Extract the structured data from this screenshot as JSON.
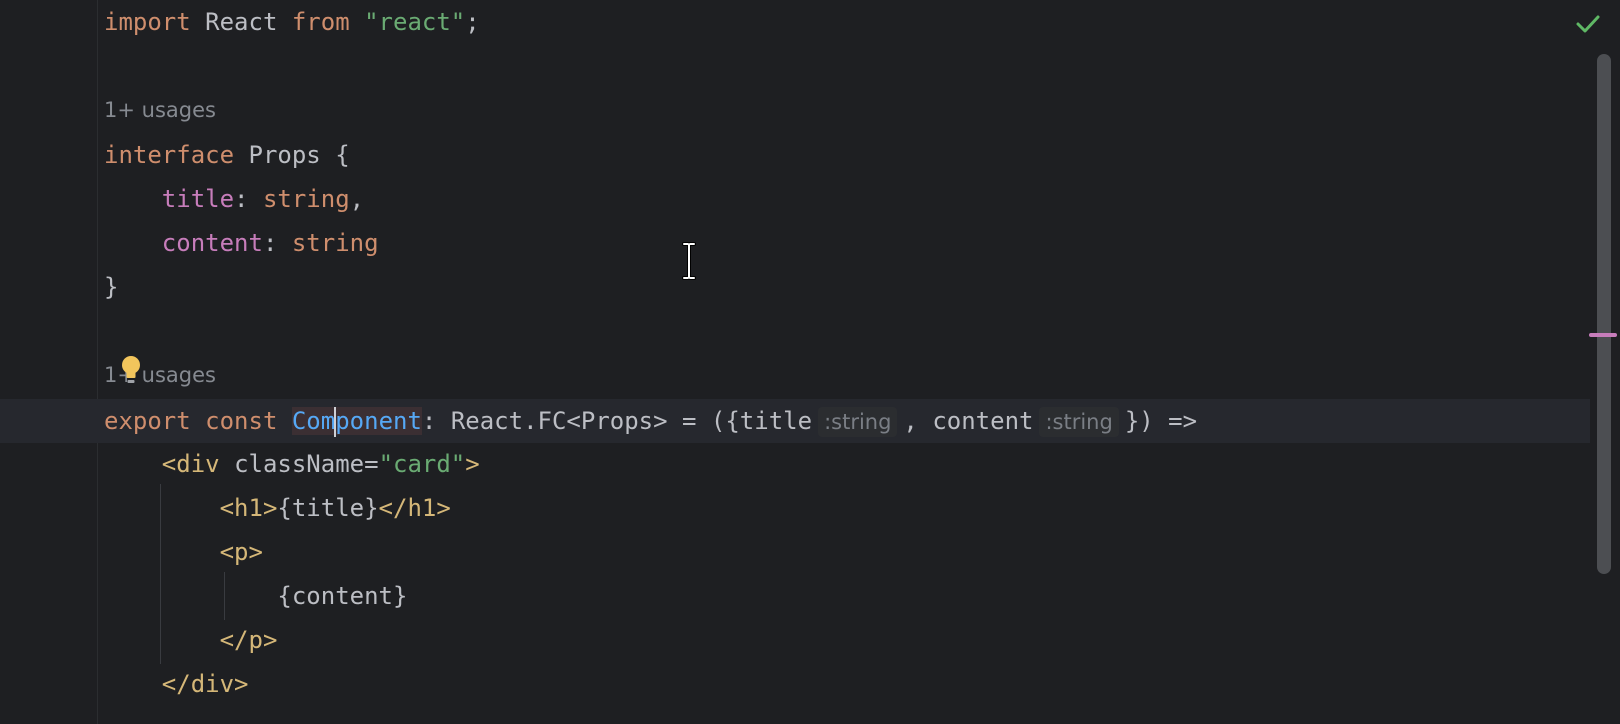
{
  "editor": {
    "lines": {
      "import": {
        "kw1": "import",
        "name": "React",
        "kw2": "from",
        "module": "\"react\"",
        "semi": ";"
      },
      "usages_1": "1+ usages",
      "interface": {
        "kw": "interface",
        "name": "Props",
        "open": "{"
      },
      "title_field": {
        "name": "title",
        "colon": ":",
        "type": "string",
        "comma": ","
      },
      "content_field": {
        "name": "content",
        "colon": ":",
        "type": "string"
      },
      "interface_close": "}",
      "usages_2": "1+ usages",
      "export": {
        "kw1": "export",
        "kw2": "const",
        "ident_before_caret": "Com",
        "ident_after_caret": "ponent",
        "rest1": ": React.FC<Props> = ({title",
        "hint1": ":string",
        "rest2": ", content",
        "hint2": ":string",
        "rest3": "}) =>"
      },
      "div_open": {
        "lt": "<",
        "tag": "div",
        "attr": "className",
        "eq": "=",
        "val": "\"card\"",
        "gt": ">"
      },
      "h1": {
        "open": "<h1>",
        "expr": "{title}",
        "close": "</h1>"
      },
      "p_open": "<p>",
      "content_expr": "{content}",
      "p_close": "</p>",
      "div_close": "</div>"
    }
  },
  "colors": {
    "background": "#1e1f22",
    "keyword": "#cf8e6d",
    "string": "#6aab73",
    "property": "#c77dbb",
    "tag": "#d5b778",
    "identifier_highlight": "#56a8f5",
    "inspection_ok": "#5fb865"
  },
  "icons": {
    "status": "checkmark-icon",
    "intention": "lightbulb-icon",
    "mouse": "text-cursor-icon"
  }
}
